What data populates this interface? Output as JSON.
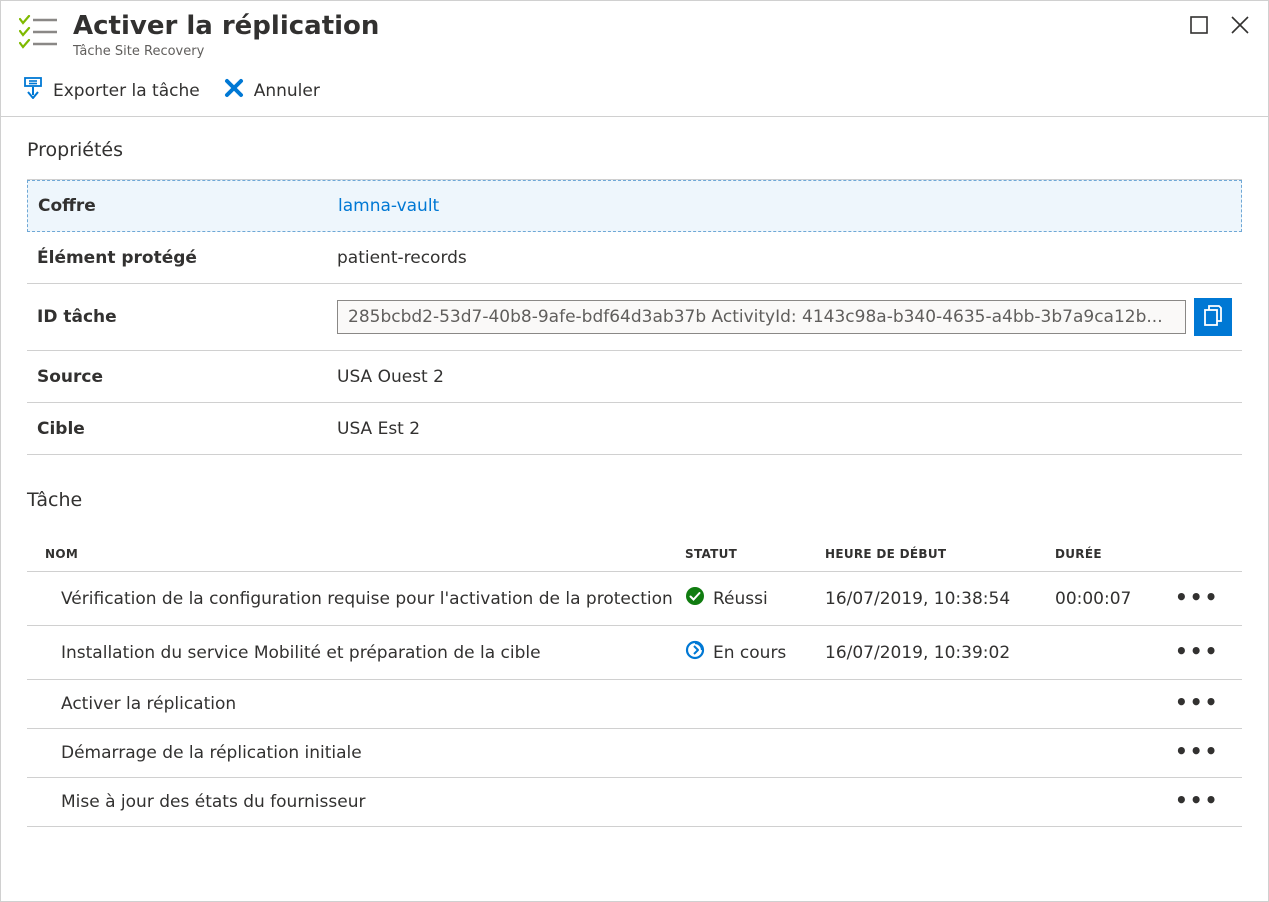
{
  "header": {
    "title": "Activer la réplication",
    "subtitle": "Tâche Site Recovery"
  },
  "toolbar": {
    "export_label": "Exporter la tâche",
    "cancel_label": "Annuler"
  },
  "properties": {
    "heading": "Propriétés",
    "rows": [
      {
        "label": "Coffre",
        "value": "lamna-vault",
        "type": "link"
      },
      {
        "label": "Élément protégé",
        "value": "patient-records",
        "type": "text"
      },
      {
        "label": "ID tâche",
        "value": "285bcbd2-53d7-40b8-9afe-bdf64d3ab37b ActivityId: 4143c98a-b340-4635-a4bb-3b7a9ca12b...",
        "type": "id"
      },
      {
        "label": "Source",
        "value": "USA Ouest 2",
        "type": "text"
      },
      {
        "label": "Cible",
        "value": "USA Est 2",
        "type": "text"
      }
    ]
  },
  "task": {
    "heading": "Tâche",
    "columns": {
      "name": "NOM",
      "status": "STATUT",
      "start": "HEURE DE DÉBUT",
      "duration": "DURÉE"
    },
    "rows": [
      {
        "name": "Vérification de la configuration requise pour l'activation de la protection",
        "status": "Réussi",
        "status_type": "success",
        "start": "16/07/2019, 10:38:54",
        "duration": "00:00:07"
      },
      {
        "name": "Installation du service Mobilité et préparation de la cible",
        "status": "En cours",
        "status_type": "progress",
        "start": "16/07/2019, 10:39:02",
        "duration": ""
      },
      {
        "name": "Activer la réplication",
        "status": "",
        "status_type": "",
        "start": "",
        "duration": ""
      },
      {
        "name": "Démarrage de la réplication initiale",
        "status": "",
        "status_type": "",
        "start": "",
        "duration": ""
      },
      {
        "name": "Mise à jour des états du fournisseur",
        "status": "",
        "status_type": "",
        "start": "",
        "duration": ""
      }
    ]
  }
}
